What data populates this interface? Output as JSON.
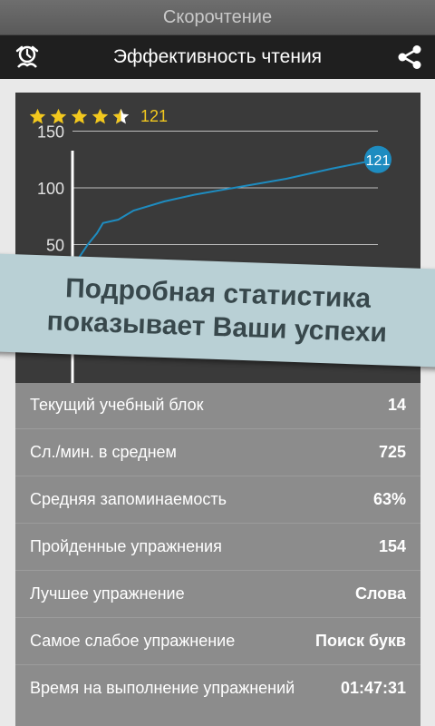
{
  "app": {
    "title": "Скорочтение"
  },
  "header": {
    "title": "Эффективность чтения",
    "left_icon": "timer-icon",
    "right_icon": "share-icon"
  },
  "rating": {
    "stars": 4.5,
    "max_stars": 5,
    "value": "121",
    "star_color": "#f2c81e"
  },
  "chart_data": {
    "type": "line",
    "x": [
      0,
      2,
      5,
      8,
      10,
      15,
      20,
      30,
      40,
      55,
      70,
      85,
      100
    ],
    "values": [
      15,
      38,
      50,
      60,
      69,
      72,
      80,
      88,
      94,
      101,
      108,
      117,
      125
    ],
    "ylim": [
      0,
      160
    ],
    "yticks": [
      "50",
      "100",
      "150"
    ],
    "ytick_values": [
      50,
      100,
      150
    ],
    "end_label": "121",
    "line_color": "#1e8cc0",
    "grid": true
  },
  "banner": {
    "line1": "Подробная статистика",
    "line2": "показывает Ваши успехи"
  },
  "stats": [
    {
      "label": "Текущий учебный блок",
      "value": "14"
    },
    {
      "label": "Сл./мин. в среднем",
      "value": "725"
    },
    {
      "label": "Средняя запоминаемость",
      "value": "63%"
    },
    {
      "label": "Пройденные упражнения",
      "value": "154"
    },
    {
      "label": "Лучшее упражнение",
      "value": "Слова"
    },
    {
      "label": "Самое слабое упражнение",
      "value": "Поиск букв"
    },
    {
      "label": "Время на выполнение упражнений",
      "value": "01:47:31"
    }
  ]
}
